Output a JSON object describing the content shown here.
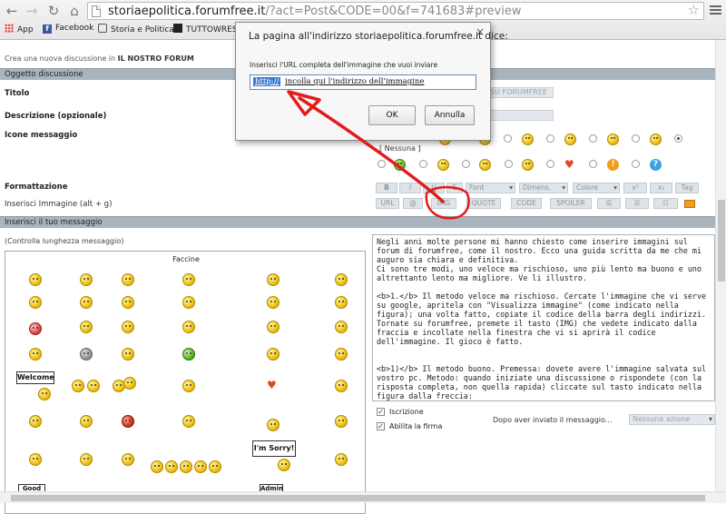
{
  "browser": {
    "url_host": "storiaepolitica.forumfree.it",
    "url_rest": "/?act=Post&CODE=00&f=741683#preview",
    "bookmarks": [
      "App",
      "Facebook",
      "Storia e Politica",
      "TUTTOWREST"
    ]
  },
  "dialog": {
    "title": "La pagina all'indirizzo storiaepolitica.forumfree.it dice:",
    "prompt": "Inserisci l'URL completa dell'immagine che vuoi inviare",
    "input_selected": "http://",
    "input_rest": "incolla qui l'indirizzo dell'immagine",
    "ok_label": "OK",
    "cancel_label": "Annulla"
  },
  "forum": {
    "breadcrumb_prefix": "Crea una nuova discussione in",
    "breadcrumb_forum": "IL NOSTRO FORUM",
    "section_topic": "Oggetto discussione",
    "title_label": "Titolo",
    "title_hint": "SU FORUMFREE",
    "description_label": "Descrizione (opzionale)",
    "icons_label": "Icone messaggio",
    "none_label": "[ Nessuna ]",
    "formatting_label": "Formattazione",
    "insert_image_label": "Inserisci Immagine (alt + g)",
    "section_message": "Inserisci il tuo messaggio",
    "check_length": "(Controlla lunghezza messaggio)",
    "faces_title": "Faccine",
    "toolbar_row1": [
      "B",
      "I",
      "U",
      "S",
      "Font",
      "Dimens.",
      "Colore",
      "x²",
      "Tag"
    ],
    "toolbar_row2": [
      "URL",
      "@",
      "IMG",
      "QUOTE",
      "CODE",
      "SPOILER"
    ],
    "signs": {
      "welcome": "Welcome",
      "sorry": "I'm Sorry!",
      "good": "Good",
      "admin": "Admin"
    },
    "message_text": "Negli anni molte persone mi hanno chiesto come inserire immagini sul forum di forumfree, come il nostro. Ecco una guida scritta da me che mi auguro sia chiara e definitiva.\nCi sono tre modi, uno veloce ma rischioso, uno più lento ma buono e uno altrettanto lento ma migliore. Ve li illustro.\n\n<b>1.</b> Il metodo veloce ma rischioso. Cercate l'immagine che vi serve su google, apritela con \"Visualizza immagine\" (come indicato nella figura); una volta fatto, copiate il codice della barra degli indirizzi.\nTornate su forumfree, premete il tasto (IMG) che vedete indicato dalla fraccia e incollate nella finestra che vi si aprirà il codice dell'immagine. Il gioco è fatto.\n\n\n<b>1)</b> Il metodo buono. Premessa: dovete avere l'immagine salvata sul vostro pc. Metodo: quando iniziate una discussione o rispondete (con la risposta completa, non quella rapida) cliccate sul tasto indicato nella figura dalla freccia:\n\nVi si aprirà la pagina di forumfree in cui potete caricare immagini nella vostra",
    "subscribe_label": "Iscrizione",
    "signature_label": "Abilita la firma",
    "after_post_label": "Dopo aver inviato il messaggio...",
    "after_post_value": "Nessuna azione"
  },
  "colors": {
    "annotation_red": "#e31b1b",
    "section_bar": "#a9b4bd",
    "selection_blue": "#3b78d8"
  }
}
